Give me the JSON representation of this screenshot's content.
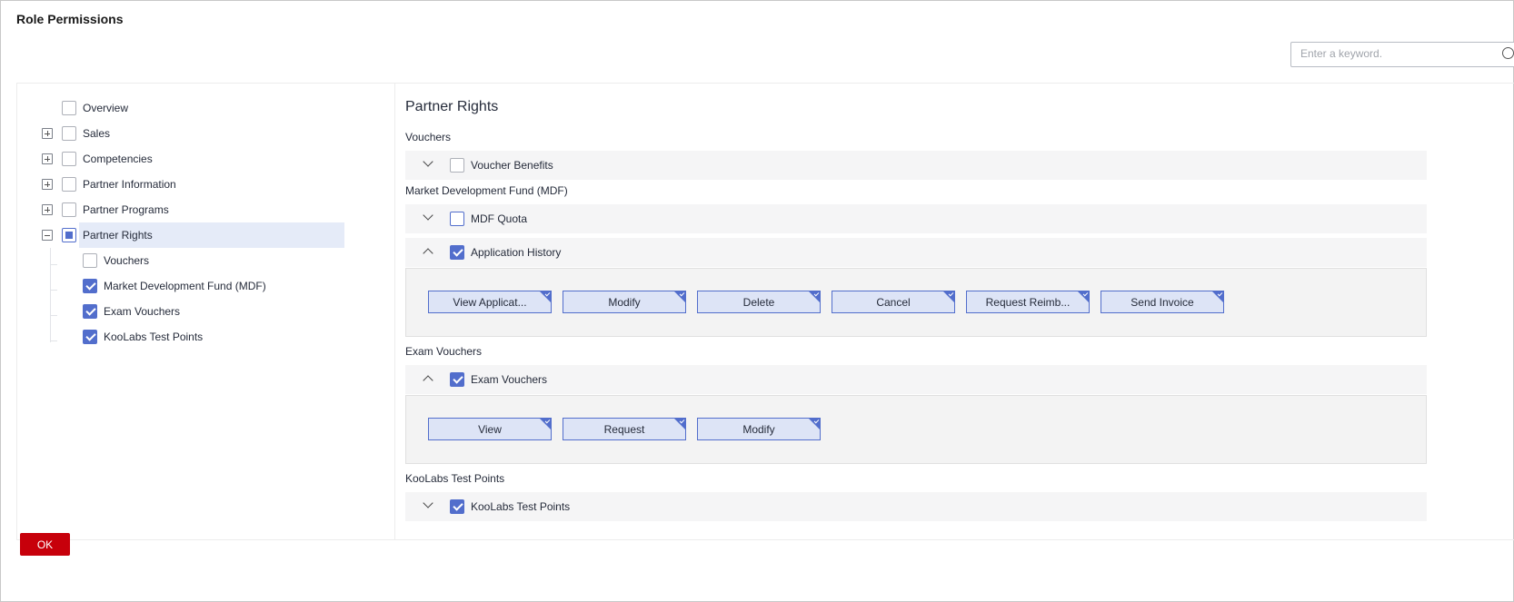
{
  "dialog": {
    "title": "Role Permissions",
    "ok_label": "OK"
  },
  "search": {
    "placeholder": "Enter a keyword."
  },
  "tree": {
    "items": [
      {
        "label": "Overview",
        "expander": "none",
        "check": "unchecked"
      },
      {
        "label": "Sales",
        "expander": "plus",
        "check": "unchecked"
      },
      {
        "label": "Competencies",
        "expander": "plus",
        "check": "unchecked"
      },
      {
        "label": "Partner Information",
        "expander": "plus",
        "check": "unchecked"
      },
      {
        "label": "Partner Programs",
        "expander": "plus",
        "check": "unchecked"
      },
      {
        "label": "Partner Rights",
        "expander": "minus",
        "check": "partial",
        "selected": true
      }
    ],
    "children": [
      {
        "label": "Vouchers",
        "check": "unchecked"
      },
      {
        "label": "Market Development Fund (MDF)",
        "check": "checked"
      },
      {
        "label": "Exam Vouchers",
        "check": "checked"
      },
      {
        "label": "KooLabs Test Points",
        "check": "checked"
      }
    ]
  },
  "detail": {
    "title": "Partner Rights",
    "sections": {
      "vouchers": {
        "label": "Vouchers",
        "rows": [
          {
            "label": "Voucher Benefits",
            "check": "unchecked",
            "expanded": false
          }
        ]
      },
      "mdf": {
        "label": "Market Development Fund (MDF)",
        "rows": [
          {
            "label": "MDF Quota",
            "check": "unchecked",
            "expanded": false
          },
          {
            "label": "Application History",
            "check": "checked",
            "expanded": true,
            "permissions": [
              "View Applicat...",
              "Modify",
              "Delete",
              "Cancel",
              "Request Reimb...",
              "Send Invoice"
            ]
          }
        ]
      },
      "exam": {
        "label": "Exam Vouchers",
        "rows": [
          {
            "label": "Exam Vouchers",
            "check": "checked",
            "expanded": true,
            "permissions": [
              "View",
              "Request",
              "Modify"
            ]
          }
        ]
      },
      "koolabs": {
        "label": "KooLabs Test Points",
        "rows": [
          {
            "label": "KooLabs Test Points",
            "check": "checked",
            "expanded": false
          }
        ]
      }
    }
  },
  "colors": {
    "accent": "#526ecc",
    "ok_button": "#c7000b",
    "selected_bg": "#e5ebf8"
  }
}
